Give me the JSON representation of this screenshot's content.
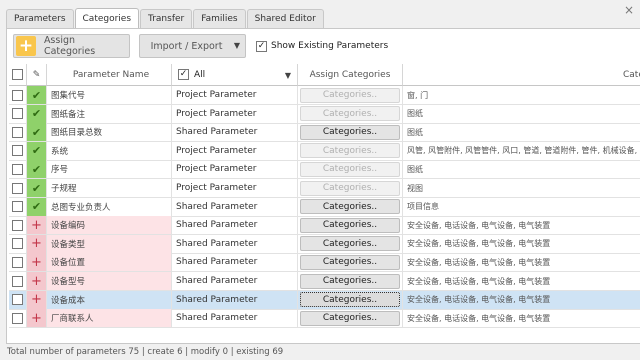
{
  "tabs": [
    {
      "label": "Parameters",
      "active": false
    },
    {
      "label": "Categories",
      "active": true
    },
    {
      "label": "Transfer",
      "active": false
    },
    {
      "label": "Families",
      "active": false
    },
    {
      "label": "Shared Editor",
      "active": false
    }
  ],
  "window": {
    "close_glyph": "×"
  },
  "toolbar": {
    "assign_label": "Assign Categories",
    "assign_icon": "plus-icon",
    "import_export_label": "Import / Export",
    "show_existing_label": "Show Existing Parameters",
    "show_existing_checked": true
  },
  "header": {
    "pencil_glyph": "✎",
    "parameter_name": "Parameter Name",
    "type_filter": "All",
    "type_filter_checked": true,
    "assign_categories": "Assign Categories",
    "categories": "Categories"
  },
  "rows": [
    {
      "status": "existing",
      "glyph": "✔",
      "name": "图集代号",
      "type": "Project Parameter",
      "category_button": "Categories..",
      "enabled": false,
      "categories": "窗, 门"
    },
    {
      "status": "existing",
      "glyph": "✔",
      "name": "图纸备注",
      "type": "Project Parameter",
      "category_button": "Categories..",
      "enabled": false,
      "categories": "图纸"
    },
    {
      "status": "existing",
      "glyph": "✔",
      "name": "图纸目录总数",
      "type": "Shared Parameter",
      "category_button": "Categories..",
      "enabled": true,
      "categories": "图纸"
    },
    {
      "status": "existing",
      "glyph": "✔",
      "name": "系统",
      "type": "Project Parameter",
      "category_button": "Categories..",
      "enabled": false,
      "categories": "风管, 风管附件, 风管管件, 风口, 管道, 管道附件, 管件, 机械设备, 卫"
    },
    {
      "status": "existing",
      "glyph": "✔",
      "name": "序号",
      "type": "Project Parameter",
      "category_button": "Categories..",
      "enabled": false,
      "categories": "图纸"
    },
    {
      "status": "existing",
      "glyph": "✔",
      "name": "子规程",
      "type": "Project Parameter",
      "category_button": "Categories..",
      "enabled": false,
      "categories": "视图"
    },
    {
      "status": "existing",
      "glyph": "✔",
      "name": "总图专业负责人",
      "type": "Shared Parameter",
      "category_button": "Categories..",
      "enabled": true,
      "categories": "项目信息"
    },
    {
      "status": "new",
      "glyph": "+",
      "name": "设备编码",
      "type": "Shared Parameter",
      "category_button": "Categories..",
      "enabled": true,
      "categories": "安全设备, 电话设备, 电气设备, 电气装置"
    },
    {
      "status": "new",
      "glyph": "+",
      "name": "设备类型",
      "type": "Shared Parameter",
      "category_button": "Categories..",
      "enabled": true,
      "categories": "安全设备, 电话设备, 电气设备, 电气装置"
    },
    {
      "status": "new",
      "glyph": "+",
      "name": "设备位置",
      "type": "Shared Parameter",
      "category_button": "Categories..",
      "enabled": true,
      "categories": "安全设备, 电话设备, 电气设备, 电气装置"
    },
    {
      "status": "new",
      "glyph": "+",
      "name": "设备型号",
      "type": "Shared Parameter",
      "category_button": "Categories..",
      "enabled": true,
      "categories": "安全设备, 电话设备, 电气设备, 电气装置"
    },
    {
      "status": "new",
      "glyph": "+",
      "name": "设备成本",
      "type": "Shared Parameter",
      "category_button": "Categories..",
      "enabled": true,
      "selected": true,
      "categories": "安全设备, 电话设备, 电气设备, 电气装置"
    },
    {
      "status": "new",
      "glyph": "+",
      "name": "厂商联系人",
      "type": "Shared Parameter",
      "category_button": "Categories..",
      "enabled": true,
      "categories": "安全设备, 电话设备, 电气设备, 电气装置"
    }
  ],
  "status_bar": "Total number of parameters 75 | create 6 | modify 0 | existing 69",
  "colors": {
    "existing": "#8fd16a",
    "new": "#f4c7cd",
    "accent": "#f9c64d",
    "selected": "#cfe3f4"
  }
}
